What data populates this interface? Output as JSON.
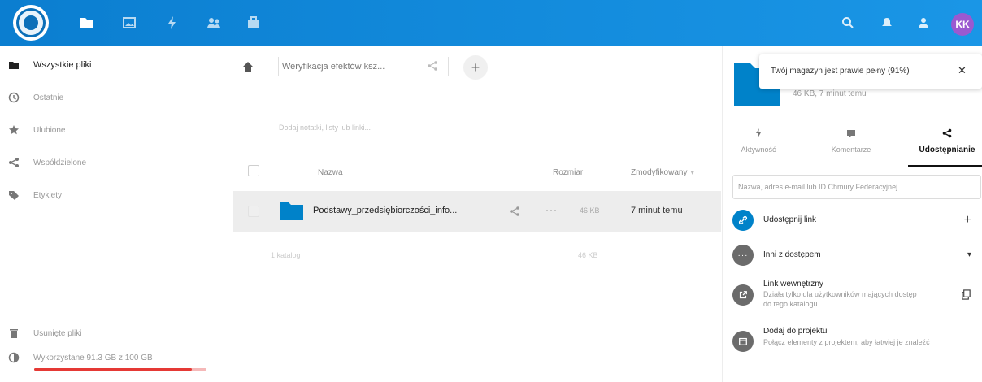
{
  "colors": {
    "header_blue": "#0b7ed0",
    "avatar_purple": "#9b59d0",
    "quota_red": "#e53935",
    "folder_blue": "#0082c9"
  },
  "header": {
    "apps": [
      {
        "icon": "files-icon",
        "active": true
      },
      {
        "icon": "photos-icon"
      },
      {
        "icon": "activity-icon"
      },
      {
        "icon": "contacts-icon"
      },
      {
        "icon": "deck-icon"
      }
    ],
    "avatar_initials": "KK"
  },
  "sidebar": {
    "items": [
      {
        "label": "Wszystkie pliki",
        "icon": "folder-icon",
        "active": true
      },
      {
        "label": "Ostatnie",
        "icon": "clock-icon"
      },
      {
        "label": "Ulubione",
        "icon": "star-icon"
      },
      {
        "label": "Współdzielone",
        "icon": "share-icon"
      },
      {
        "label": "Etykiety",
        "icon": "tag-icon"
      }
    ],
    "deleted_label": "Usunięte pliki",
    "quota_label": "Wykorzystane 91.3 GB z 100 GB",
    "quota_fraction": 0.913
  },
  "breadcrumb": {
    "current": "Weryfikacja efektów ksz..."
  },
  "notes_placeholder": "Dodaj notatki, listy lub linki...",
  "table": {
    "headers": {
      "name": "Nazwa",
      "size": "Rozmiar",
      "modified": "Zmodyfikowany",
      "sort_indicator": "▾"
    },
    "rows": [
      {
        "name": "Podstawy_przedsiębiorczości_info...",
        "size": "46 KB",
        "modified": "7 minut temu",
        "more": "···"
      }
    ],
    "summary": {
      "count": "1 katalog",
      "size": "46 KB"
    }
  },
  "panel": {
    "meta": "46 KB, 7 minut temu",
    "toast": {
      "text": "Twój magazyn jest prawie pełny (91%)",
      "close": "✕"
    },
    "tabs": [
      {
        "label": "Aktywność",
        "icon": "activity-icon"
      },
      {
        "label": "Komentarze",
        "icon": "comment-icon"
      },
      {
        "label": "Udostępnianie",
        "icon": "share-icon",
        "active": true
      }
    ],
    "share_placeholder": "Nazwa, adres e-mail lub ID Chmury Federacyjnej...",
    "share_link": {
      "label": "Udostępnij link",
      "action": "+"
    },
    "others": {
      "label": "Inni z dostępem",
      "action": "▾"
    },
    "internal_link": {
      "title": "Link wewnętrzny",
      "desc": "Działa tylko dla użytkowników mających dostęp do tego katalogu"
    },
    "project": {
      "title": "Dodaj do projektu",
      "desc": "Połącz elementy z projektem, aby łatwiej je znaleźć"
    }
  }
}
